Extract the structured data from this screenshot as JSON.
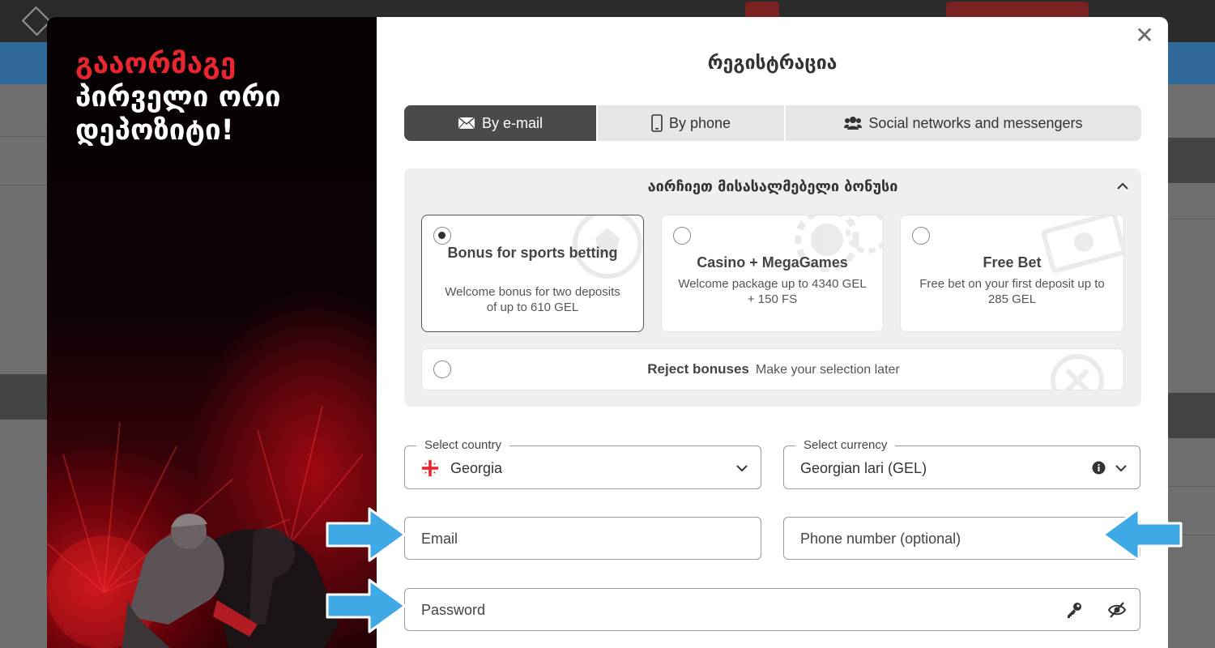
{
  "promo": {
    "line1": "გააორმაგე",
    "line2": "პირველი ორი",
    "line3": "დეპოზიტი!"
  },
  "modal": {
    "close_symbol": "✕",
    "title": "რეგისტრაცია"
  },
  "tabs": [
    {
      "label": "By e-mail",
      "icon": "envelope-icon",
      "active": true
    },
    {
      "label": "By phone",
      "icon": "smartphone-icon",
      "active": false
    },
    {
      "label": "Social networks and messengers",
      "icon": "users-icon",
      "active": false
    }
  ],
  "bonus": {
    "title": "აირჩიეთ მისასალმებელი ბონუსი",
    "cards": [
      {
        "name": "Bonus for sports betting",
        "description": "Welcome bonus for two deposits of up to 610 GEL",
        "selected": true
      },
      {
        "name": "Casino + MegaGames",
        "description": "Welcome package up to 4340 GEL + 150 FS",
        "selected": false
      },
      {
        "name": "Free Bet",
        "description": "Free bet on your first deposit up to 285 GEL",
        "selected": false
      }
    ],
    "reject": {
      "label": "Reject bonuses",
      "hint": "Make your selection later",
      "selected": false
    }
  },
  "form": {
    "country": {
      "label": "Select country",
      "value": "Georgia"
    },
    "currency": {
      "label": "Select currency",
      "value": "Georgian lari (GEL)"
    },
    "email": {
      "placeholder": "Email"
    },
    "phone": {
      "placeholder": "Phone number (optional)"
    },
    "password": {
      "placeholder": "Password"
    }
  },
  "colors": {
    "accent_red": "#e8262f",
    "tab_active": "#4a4a4a",
    "arrow_blue": "#3fa9e6"
  }
}
